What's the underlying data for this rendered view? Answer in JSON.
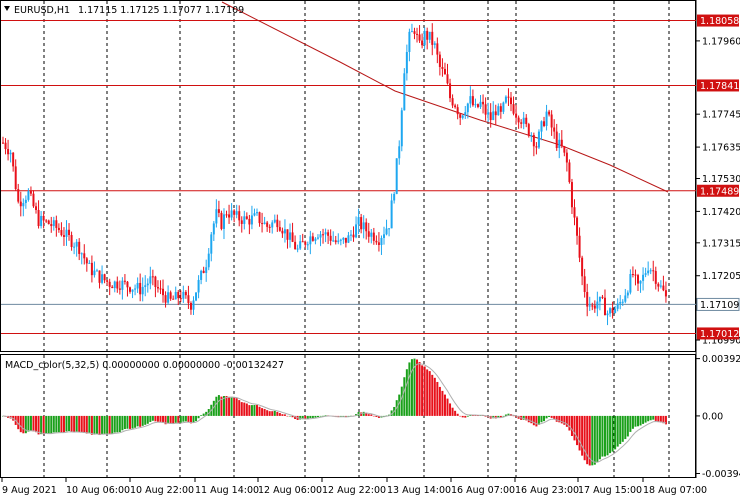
{
  "header": {
    "symbol_tf": "EURUSD,H1",
    "ohlc": "1.17115 1.17125 1.17077 1.17109",
    "collapse_icon": "triangle-down-icon"
  },
  "macd": {
    "label": "MACD_color(5,32,5) 0.00000000 0.00000000 -0.00132427"
  },
  "price_axis": {
    "ticks": [
      "1.17960",
      "1.17745",
      "1.17635",
      "1.17530",
      "1.17420",
      "1.17315",
      "1.17205",
      "1.16990"
    ]
  },
  "level_badges": [
    "1.18058",
    "1.17841",
    "1.17489",
    "1.17012"
  ],
  "current_price": "1.17109",
  "macd_axis": {
    "ticks": [
      "0.0039206",
      "0.00",
      "-0.003943"
    ]
  },
  "time_axis": {
    "labels": [
      "9 Aug 2021",
      "10 Aug 06:00",
      "10 Aug 22:00",
      "11 Aug 14:00",
      "12 Aug 06:00",
      "12 Aug 22:00",
      "13 Aug 14:00",
      "16 Aug 07:00",
      "16 Aug 23:00",
      "17 Aug 15:00",
      "18 Aug 07:00"
    ]
  },
  "colors": {
    "bull": "#1ea7f0",
    "bear": "#e8101a",
    "level_line": "#d01010",
    "ma_line": "#b81818",
    "macd_up": "#1aa01a",
    "macd_down": "#e8101a",
    "signal_line": "#b0b0b0",
    "grid": "#000000",
    "current_line": "#6e8aa0"
  },
  "chart_data": [
    {
      "type": "candlestick",
      "title": "EURUSD,H1",
      "ylim": [
        1.1695,
        1.1812
      ],
      "y_ticks": [
        1.1799,
        1.17745,
        1.17635,
        1.1753,
        1.1742,
        1.17315,
        1.17205,
        1.1699
      ],
      "horizontal_levels": [
        1.18058,
        1.17841,
        1.17489,
        1.17012
      ],
      "current_price": 1.17109,
      "ma_line_label": "moving average",
      "close_path": [
        [
          0,
          1.1765
        ],
        [
          3,
          1.1762
        ],
        [
          6,
          1.1745
        ],
        [
          10,
          1.1748
        ],
        [
          14,
          1.1739
        ],
        [
          18,
          1.1738
        ],
        [
          22,
          1.1736
        ],
        [
          26,
          1.1733
        ],
        [
          30,
          1.173
        ],
        [
          34,
          1.1723
        ],
        [
          38,
          1.172
        ],
        [
          42,
          1.1718
        ],
        [
          46,
          1.1718
        ],
        [
          50,
          1.1717
        ],
        [
          54,
          1.1716
        ],
        [
          58,
          1.1719
        ],
        [
          62,
          1.1715
        ],
        [
          66,
          1.1712
        ],
        [
          70,
          1.1714
        ],
        [
          74,
          1.1711
        ],
        [
          77,
          1.1718
        ],
        [
          80,
          1.1725
        ],
        [
          82,
          1.1735
        ],
        [
          84,
          1.1741
        ],
        [
          86,
          1.1738
        ],
        [
          88,
          1.1742
        ],
        [
          92,
          1.174
        ],
        [
          96,
          1.1739
        ],
        [
          100,
          1.174
        ],
        [
          104,
          1.1737
        ],
        [
          108,
          1.1739
        ],
        [
          112,
          1.1734
        ],
        [
          116,
          1.1729
        ],
        [
          120,
          1.1733
        ],
        [
          124,
          1.1735
        ],
        [
          128,
          1.1734
        ],
        [
          132,
          1.1731
        ],
        [
          136,
          1.1733
        ],
        [
          140,
          1.1738
        ],
        [
          144,
          1.1735
        ],
        [
          148,
          1.1733
        ],
        [
          152,
          1.1738
        ],
        [
          154,
          1.175
        ],
        [
          156,
          1.1765
        ],
        [
          158,
          1.179
        ],
        [
          160,
          1.18
        ],
        [
          162,
          1.1803
        ],
        [
          164,
          1.1797
        ],
        [
          166,
          1.1801
        ],
        [
          168,
          1.18
        ],
        [
          170,
          1.1797
        ],
        [
          172,
          1.179
        ],
        [
          174,
          1.1787
        ],
        [
          176,
          1.178
        ],
        [
          178,
          1.1778
        ],
        [
          180,
          1.1774
        ],
        [
          182,
          1.1777
        ],
        [
          184,
          1.1779
        ],
        [
          186,
          1.1776
        ],
        [
          188,
          1.1778
        ],
        [
          190,
          1.1775
        ],
        [
          192,
          1.1773
        ],
        [
          194,
          1.1776
        ],
        [
          196,
          1.1774
        ],
        [
          198,
          1.1779
        ],
        [
          200,
          1.1778
        ],
        [
          202,
          1.1775
        ],
        [
          204,
          1.1773
        ],
        [
          206,
          1.177
        ],
        [
          208,
          1.1768
        ],
        [
          210,
          1.1764
        ],
        [
          212,
          1.177
        ],
        [
          214,
          1.1775
        ],
        [
          216,
          1.177
        ],
        [
          218,
          1.1765
        ],
        [
          220,
          1.1763
        ],
        [
          222,
          1.1758
        ],
        [
          224,
          1.1745
        ],
        [
          226,
          1.1733
        ],
        [
          228,
          1.172
        ],
        [
          230,
          1.1712
        ],
        [
          232,
          1.171
        ],
        [
          234,
          1.1712
        ],
        [
          236,
          1.1711
        ],
        [
          238,
          1.1708
        ],
        [
          240,
          1.1709
        ],
        [
          242,
          1.171
        ],
        [
          244,
          1.1713
        ],
        [
          246,
          1.1717
        ],
        [
          248,
          1.1721
        ],
        [
          250,
          1.1716
        ],
        [
          252,
          1.172
        ],
        [
          254,
          1.1724
        ],
        [
          256,
          1.1722
        ],
        [
          258,
          1.1718
        ],
        [
          260,
          1.1715
        ],
        [
          262,
          1.1711
        ]
      ]
    },
    {
      "type": "bar",
      "title": "MACD_color(5,32,5)",
      "ylim": [
        -0.00425,
        0.0041
      ],
      "y_ticks": [
        0.0039206,
        0.0,
        -0.003943
      ],
      "positive_color": "green",
      "negative_color": "red"
    }
  ]
}
